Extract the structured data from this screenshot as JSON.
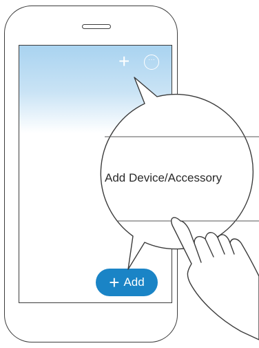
{
  "top_bar": {
    "add_icon": "plus-icon",
    "more_icon": "more-icon",
    "more_glyph": "···"
  },
  "callout": {
    "menu_item": "Add Device/Accessory"
  },
  "bottom_button": {
    "plus_glyph": "+",
    "label": "Add"
  },
  "colors": {
    "accent": "#1a84c6",
    "screen_top": "#a9d3f0",
    "outline": "#3b3b3b"
  }
}
